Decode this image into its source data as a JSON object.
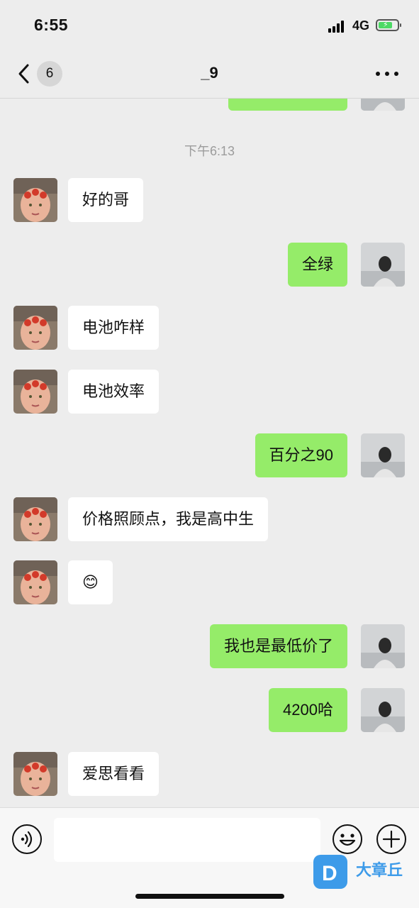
{
  "status_bar": {
    "time": "6:55",
    "network": "4G"
  },
  "nav": {
    "back_count": "6",
    "title": "_9"
  },
  "chat": {
    "timestamp": "下午6:13",
    "messages": [
      {
        "side": "in",
        "text": "好的哥"
      },
      {
        "side": "out",
        "text": "全绿"
      },
      {
        "side": "in",
        "text": "电池咋样"
      },
      {
        "side": "in",
        "text": "电池效率"
      },
      {
        "side": "out",
        "text": "百分之90"
      },
      {
        "side": "in",
        "text": "价格照顾点，我是高中生"
      },
      {
        "side": "in",
        "text": "😊"
      },
      {
        "side": "out",
        "text": "我也是最低价了"
      },
      {
        "side": "out",
        "text": "4200哈"
      },
      {
        "side": "in",
        "text": "爱思看看"
      }
    ]
  },
  "input_bar": {
    "value": "",
    "placeholder": ""
  },
  "watermark": {
    "text": "大章丘"
  },
  "colors": {
    "outgoing_bubble": "#95ec69",
    "incoming_bubble": "#ffffff",
    "background": "#ededed"
  }
}
